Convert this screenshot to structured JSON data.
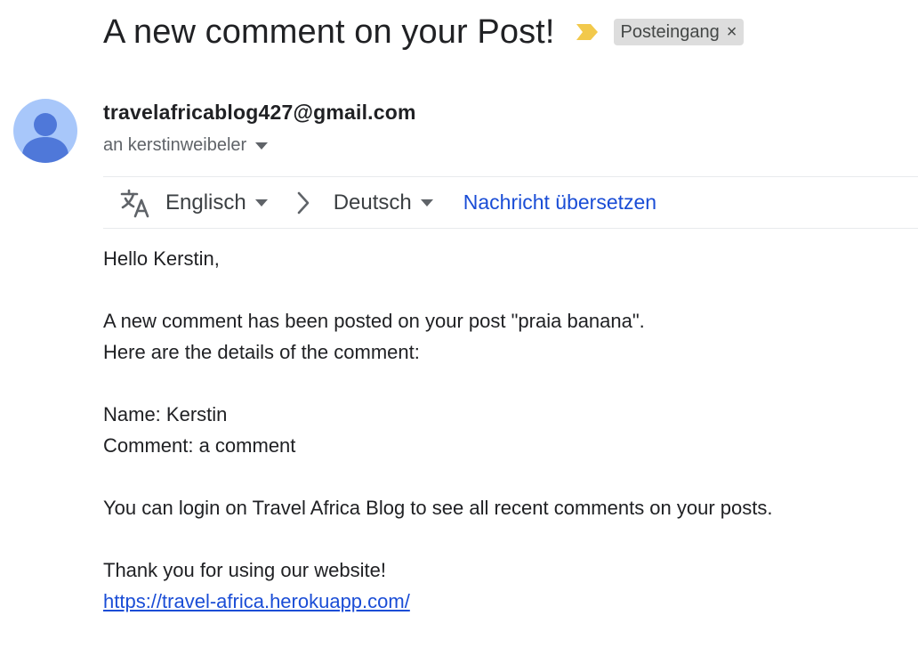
{
  "email": {
    "subject": "A new comment on your Post!",
    "label": "Posteingang",
    "label_remove": "×",
    "importance_marker_color": "#f2c94c",
    "importance_icon": "importance-marker-icon"
  },
  "sender": {
    "email": "travelafricablog427@gmail.com",
    "recipient_line": "an kerstinweibeler",
    "avatar_icon": "person-avatar-icon",
    "avatar_bg": "#a8c7fa",
    "avatar_fg": "#4f78d9"
  },
  "translate": {
    "icon": "translate-icon",
    "source_language": "Englisch",
    "target_language": "Deutsch",
    "action_label": "Nachricht übersetzen",
    "link_color": "#1a4dd6"
  },
  "body": {
    "greeting": "Hello Kerstin,",
    "line1": "A new comment has been posted on your post \"praia banana\".",
    "line2": "Here are the details of the comment:",
    "name_line": "Name: Kerstin",
    "comment_line": "Comment: a comment",
    "login_line": "You can login on Travel Africa Blog to see all recent comments on your posts.",
    "thanks_line": "Thank you for using our website!",
    "url": "https://travel-africa.herokuapp.com/"
  }
}
